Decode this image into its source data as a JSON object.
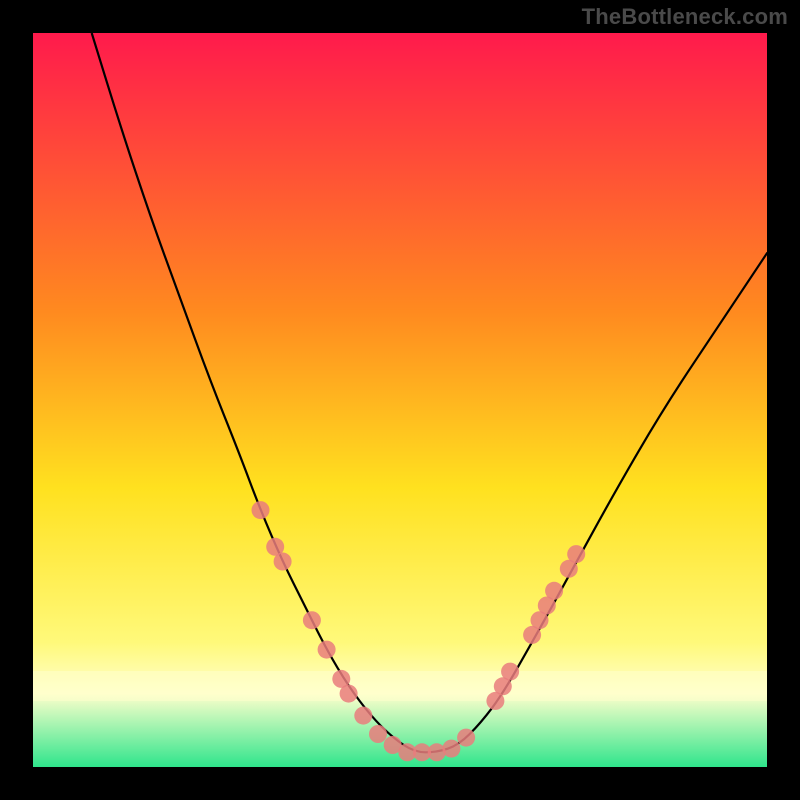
{
  "watermark": "TheBottleneck.com",
  "chart_data": {
    "type": "line",
    "title": "",
    "xlabel": "",
    "ylabel": "",
    "xlim": [
      0,
      100
    ],
    "ylim": [
      0,
      100
    ],
    "grid": false,
    "legend": false,
    "background_gradient": {
      "top_color": "#ff1a4c",
      "mid_colors": [
        "#ff8a1f",
        "#ffe11f",
        "#fff97a"
      ],
      "band_color": "#ffffcc",
      "bottom_color": "#2fe58c"
    },
    "series": [
      {
        "name": "bottleneck-curve",
        "x": [
          8,
          12,
          16,
          20,
          24,
          28,
          31,
          34,
          37,
          40,
          43,
          46,
          49,
          52,
          55,
          58,
          61,
          64,
          68,
          73,
          79,
          86,
          94,
          100
        ],
        "y": [
          100,
          87,
          75,
          64,
          53,
          43,
          35,
          28,
          22,
          16,
          11,
          7,
          4,
          2,
          2,
          3,
          6,
          10,
          17,
          26,
          37,
          49,
          61,
          70
        ]
      }
    ],
    "markers": {
      "name": "highlight-dots",
      "color": "#e97c7c",
      "points": [
        {
          "x": 31,
          "y": 35
        },
        {
          "x": 33,
          "y": 30
        },
        {
          "x": 34,
          "y": 28
        },
        {
          "x": 38,
          "y": 20
        },
        {
          "x": 40,
          "y": 16
        },
        {
          "x": 42,
          "y": 12
        },
        {
          "x": 43,
          "y": 10
        },
        {
          "x": 45,
          "y": 7
        },
        {
          "x": 47,
          "y": 4.5
        },
        {
          "x": 49,
          "y": 3
        },
        {
          "x": 51,
          "y": 2
        },
        {
          "x": 53,
          "y": 2
        },
        {
          "x": 55,
          "y": 2
        },
        {
          "x": 57,
          "y": 2.5
        },
        {
          "x": 59,
          "y": 4
        },
        {
          "x": 63,
          "y": 9
        },
        {
          "x": 64,
          "y": 11
        },
        {
          "x": 65,
          "y": 13
        },
        {
          "x": 68,
          "y": 18
        },
        {
          "x": 69,
          "y": 20
        },
        {
          "x": 70,
          "y": 22
        },
        {
          "x": 71,
          "y": 24
        },
        {
          "x": 73,
          "y": 27
        },
        {
          "x": 74,
          "y": 29
        }
      ]
    }
  }
}
